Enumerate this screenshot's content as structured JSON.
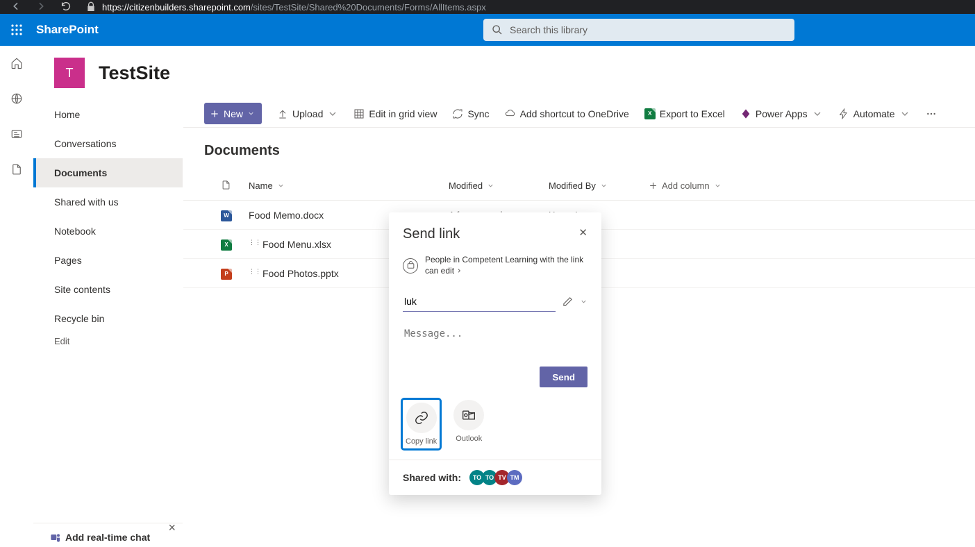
{
  "browser": {
    "url_host": "https://citizenbuilders.sharepoint.com",
    "url_path": "/sites/TestSite/Shared%20Documents/Forms/AllItems.aspx"
  },
  "suite": {
    "app_name": "SharePoint",
    "search_placeholder": "Search this library"
  },
  "site": {
    "logo_letter": "T",
    "title": "TestSite"
  },
  "nav": {
    "items": [
      "Home",
      "Conversations",
      "Documents",
      "Shared with us",
      "Notebook",
      "Pages",
      "Site contents",
      "Recycle bin"
    ],
    "edit": "Edit",
    "active_index": 2
  },
  "chat_promo": {
    "title": "Add real-time chat"
  },
  "commands": {
    "new": "New",
    "upload": "Upload",
    "grid": "Edit in grid view",
    "sync": "Sync",
    "shortcut": "Add shortcut to OneDrive",
    "excel": "Export to Excel",
    "power": "Power Apps",
    "automate": "Automate"
  },
  "page_title": "Documents",
  "columns": {
    "name": "Name",
    "modified": "Modified",
    "modified_by": "Modified By",
    "add": "Add column"
  },
  "files": [
    {
      "name": "Food Memo.docx",
      "type": "docx",
      "modified": "A few seconds ago",
      "modified_by": "Henry Legge",
      "new": false
    },
    {
      "name": "Food Menu.xlsx",
      "type": "xlsx",
      "modified": "",
      "modified_by": "",
      "new": true
    },
    {
      "name": "Food Photos.pptx",
      "type": "pptx",
      "modified": "",
      "modified_by": "",
      "new": true
    }
  ],
  "dialog": {
    "title": "Send link",
    "scope": "People in Competent Learning with the link can edit",
    "input_value": "luk",
    "message_placeholder": "Message...",
    "send": "Send",
    "copy_link": "Copy link",
    "outlook": "Outlook",
    "shared_with": "Shared with:",
    "avatars": [
      {
        "initials": "TO",
        "color": "#038387"
      },
      {
        "initials": "TO",
        "color": "#038387"
      },
      {
        "initials": "TV",
        "color": "#a4262c"
      },
      {
        "initials": "TM",
        "color": "#5c6bc0"
      }
    ]
  }
}
